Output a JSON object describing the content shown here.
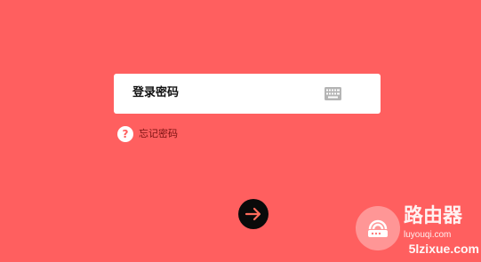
{
  "colors": {
    "background": "#ff5f5f",
    "card": "#ffffff",
    "submit_button": "#0a0a0a",
    "submit_arrow": "#ff6b5b",
    "forgot_text": "#7a1212"
  },
  "login": {
    "password_label": "登录密码",
    "keyboard_icon": "keyboard-icon",
    "forgot_password": "忘记密码",
    "help_icon_glyph": "?",
    "submit_icon": "arrow-right-icon"
  },
  "watermark": {
    "title": "路由器",
    "url": "luyouqi.com",
    "site": "5lzixue.com"
  }
}
